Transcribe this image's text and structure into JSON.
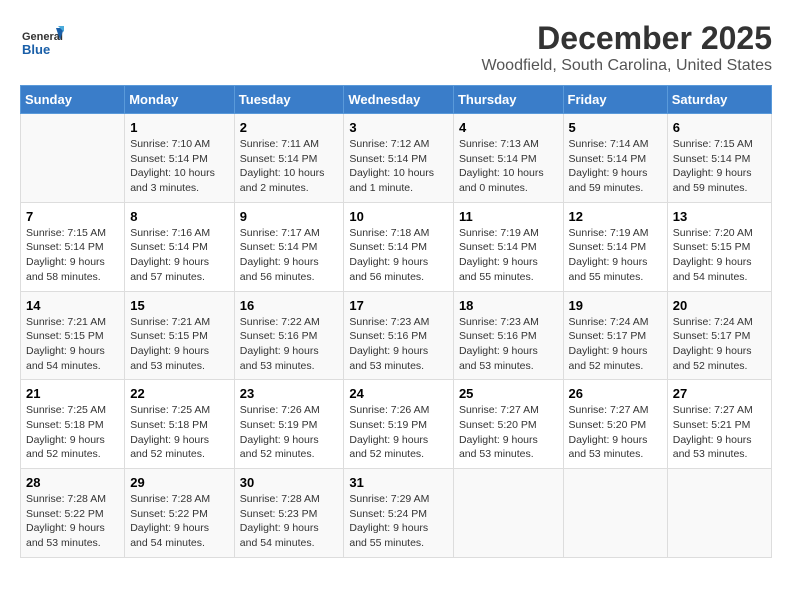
{
  "logo": {
    "general": "General",
    "blue": "Blue"
  },
  "title": "December 2025",
  "subtitle": "Woodfield, South Carolina, United States",
  "days_of_week": [
    "Sunday",
    "Monday",
    "Tuesday",
    "Wednesday",
    "Thursday",
    "Friday",
    "Saturday"
  ],
  "weeks": [
    [
      {
        "num": "",
        "info": ""
      },
      {
        "num": "1",
        "info": "Sunrise: 7:10 AM\nSunset: 5:14 PM\nDaylight: 10 hours\nand 3 minutes."
      },
      {
        "num": "2",
        "info": "Sunrise: 7:11 AM\nSunset: 5:14 PM\nDaylight: 10 hours\nand 2 minutes."
      },
      {
        "num": "3",
        "info": "Sunrise: 7:12 AM\nSunset: 5:14 PM\nDaylight: 10 hours\nand 1 minute."
      },
      {
        "num": "4",
        "info": "Sunrise: 7:13 AM\nSunset: 5:14 PM\nDaylight: 10 hours\nand 0 minutes."
      },
      {
        "num": "5",
        "info": "Sunrise: 7:14 AM\nSunset: 5:14 PM\nDaylight: 9 hours\nand 59 minutes."
      },
      {
        "num": "6",
        "info": "Sunrise: 7:15 AM\nSunset: 5:14 PM\nDaylight: 9 hours\nand 59 minutes."
      }
    ],
    [
      {
        "num": "7",
        "info": "Sunrise: 7:15 AM\nSunset: 5:14 PM\nDaylight: 9 hours\nand 58 minutes."
      },
      {
        "num": "8",
        "info": "Sunrise: 7:16 AM\nSunset: 5:14 PM\nDaylight: 9 hours\nand 57 minutes."
      },
      {
        "num": "9",
        "info": "Sunrise: 7:17 AM\nSunset: 5:14 PM\nDaylight: 9 hours\nand 56 minutes."
      },
      {
        "num": "10",
        "info": "Sunrise: 7:18 AM\nSunset: 5:14 PM\nDaylight: 9 hours\nand 56 minutes."
      },
      {
        "num": "11",
        "info": "Sunrise: 7:19 AM\nSunset: 5:14 PM\nDaylight: 9 hours\nand 55 minutes."
      },
      {
        "num": "12",
        "info": "Sunrise: 7:19 AM\nSunset: 5:14 PM\nDaylight: 9 hours\nand 55 minutes."
      },
      {
        "num": "13",
        "info": "Sunrise: 7:20 AM\nSunset: 5:15 PM\nDaylight: 9 hours\nand 54 minutes."
      }
    ],
    [
      {
        "num": "14",
        "info": "Sunrise: 7:21 AM\nSunset: 5:15 PM\nDaylight: 9 hours\nand 54 minutes."
      },
      {
        "num": "15",
        "info": "Sunrise: 7:21 AM\nSunset: 5:15 PM\nDaylight: 9 hours\nand 53 minutes."
      },
      {
        "num": "16",
        "info": "Sunrise: 7:22 AM\nSunset: 5:16 PM\nDaylight: 9 hours\nand 53 minutes."
      },
      {
        "num": "17",
        "info": "Sunrise: 7:23 AM\nSunset: 5:16 PM\nDaylight: 9 hours\nand 53 minutes."
      },
      {
        "num": "18",
        "info": "Sunrise: 7:23 AM\nSunset: 5:16 PM\nDaylight: 9 hours\nand 53 minutes."
      },
      {
        "num": "19",
        "info": "Sunrise: 7:24 AM\nSunset: 5:17 PM\nDaylight: 9 hours\nand 52 minutes."
      },
      {
        "num": "20",
        "info": "Sunrise: 7:24 AM\nSunset: 5:17 PM\nDaylight: 9 hours\nand 52 minutes."
      }
    ],
    [
      {
        "num": "21",
        "info": "Sunrise: 7:25 AM\nSunset: 5:18 PM\nDaylight: 9 hours\nand 52 minutes."
      },
      {
        "num": "22",
        "info": "Sunrise: 7:25 AM\nSunset: 5:18 PM\nDaylight: 9 hours\nand 52 minutes."
      },
      {
        "num": "23",
        "info": "Sunrise: 7:26 AM\nSunset: 5:19 PM\nDaylight: 9 hours\nand 52 minutes."
      },
      {
        "num": "24",
        "info": "Sunrise: 7:26 AM\nSunset: 5:19 PM\nDaylight: 9 hours\nand 52 minutes."
      },
      {
        "num": "25",
        "info": "Sunrise: 7:27 AM\nSunset: 5:20 PM\nDaylight: 9 hours\nand 53 minutes."
      },
      {
        "num": "26",
        "info": "Sunrise: 7:27 AM\nSunset: 5:20 PM\nDaylight: 9 hours\nand 53 minutes."
      },
      {
        "num": "27",
        "info": "Sunrise: 7:27 AM\nSunset: 5:21 PM\nDaylight: 9 hours\nand 53 minutes."
      }
    ],
    [
      {
        "num": "28",
        "info": "Sunrise: 7:28 AM\nSunset: 5:22 PM\nDaylight: 9 hours\nand 53 minutes."
      },
      {
        "num": "29",
        "info": "Sunrise: 7:28 AM\nSunset: 5:22 PM\nDaylight: 9 hours\nand 54 minutes."
      },
      {
        "num": "30",
        "info": "Sunrise: 7:28 AM\nSunset: 5:23 PM\nDaylight: 9 hours\nand 54 minutes."
      },
      {
        "num": "31",
        "info": "Sunrise: 7:29 AM\nSunset: 5:24 PM\nDaylight: 9 hours\nand 55 minutes."
      },
      {
        "num": "",
        "info": ""
      },
      {
        "num": "",
        "info": ""
      },
      {
        "num": "",
        "info": ""
      }
    ]
  ]
}
